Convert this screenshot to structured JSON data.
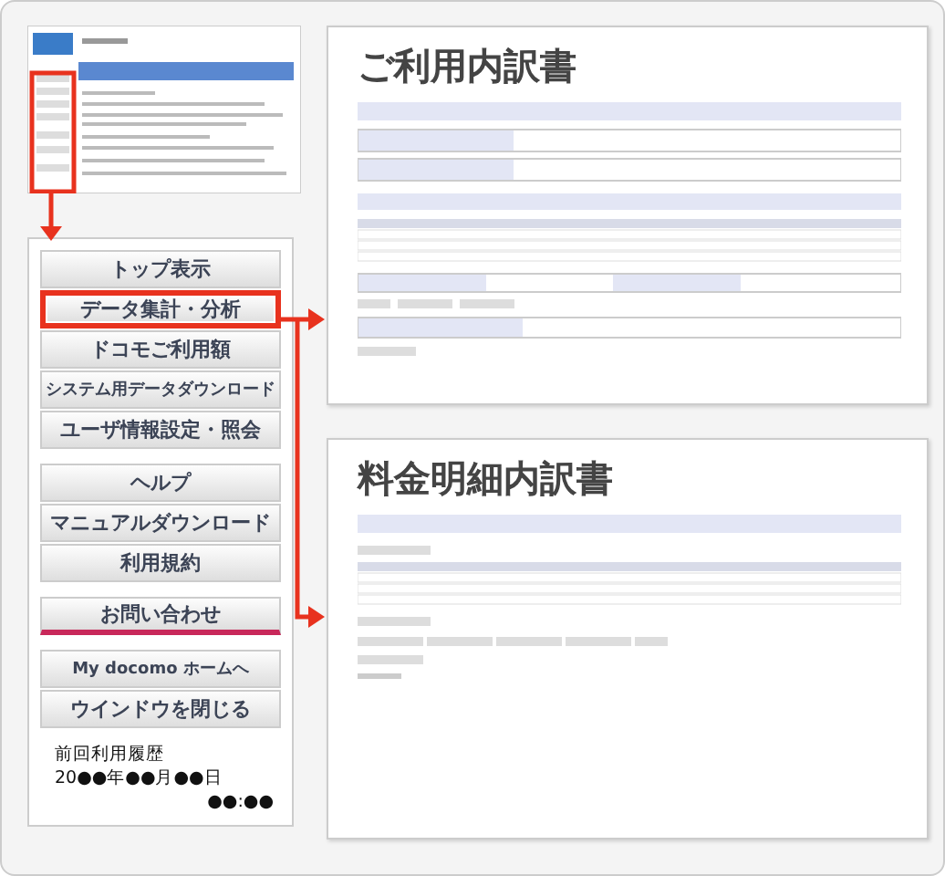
{
  "menu": {
    "groups": [
      {
        "items": [
          {
            "label": "トップ表示",
            "highlighted": false,
            "underlined": false
          },
          {
            "label": "データ集計・分析",
            "highlighted": true,
            "underlined": false
          },
          {
            "label": "ドコモご利用額",
            "highlighted": false,
            "underlined": false
          },
          {
            "label": "システム用データダウンロード",
            "highlighted": false,
            "underlined": false
          },
          {
            "label": "ユーザ情報設定・照会",
            "highlighted": false,
            "underlined": false
          }
        ]
      },
      {
        "items": [
          {
            "label": "ヘルプ",
            "highlighted": false,
            "underlined": false
          },
          {
            "label": "マニュアルダウンロード",
            "highlighted": false,
            "underlined": false
          },
          {
            "label": "利用規約",
            "highlighted": false,
            "underlined": false
          }
        ]
      },
      {
        "items": [
          {
            "label": "お問い合わせ",
            "highlighted": false,
            "underlined": true
          }
        ]
      },
      {
        "items": [
          {
            "label": "My docomo ホームへ",
            "highlighted": false,
            "underlined": false
          },
          {
            "label": "ウインドウを閉じる",
            "highlighted": false,
            "underlined": false
          }
        ]
      }
    ],
    "last_use": {
      "label": "前回利用履歴",
      "date": "20●●年●●月●●日",
      "time": "●●:●●"
    }
  },
  "screens": [
    {
      "title": "ご利用内訳書",
      "kind": "summary"
    },
    {
      "title": "料金明細内訳書",
      "kind": "detail"
    }
  ]
}
